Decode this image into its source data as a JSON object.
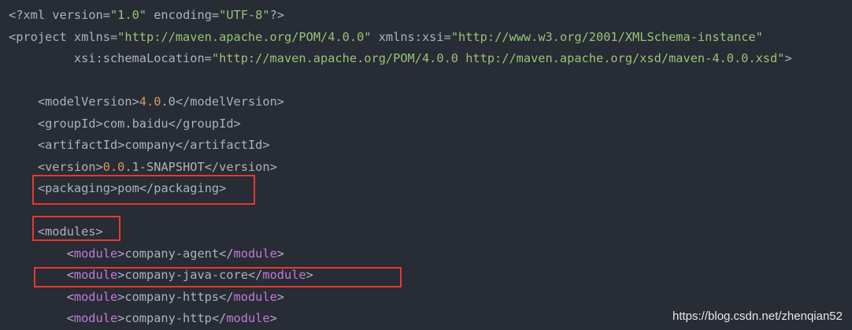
{
  "code": {
    "lines": [
      [
        {
          "t": "<?xml",
          "k": "punct"
        },
        {
          "t": " version=",
          "k": "attr"
        },
        {
          "t": "\"1.0\"",
          "k": "str"
        },
        {
          "t": " encoding=",
          "k": "attr"
        },
        {
          "t": "\"UTF-8\"",
          "k": "str"
        },
        {
          "t": "?>",
          "k": "punct"
        }
      ],
      [
        {
          "t": "<",
          "k": "punct"
        },
        {
          "t": "project",
          "k": "tag"
        },
        {
          "t": " xmlns=",
          "k": "attr"
        },
        {
          "t": "\"http://maven.apache.org/POM/4.0.0\"",
          "k": "str"
        },
        {
          "t": " xmlns:xsi=",
          "k": "attr"
        },
        {
          "t": "\"http://www.w3.org/2001/XMLSchema-instance\"",
          "k": "str"
        }
      ],
      [
        {
          "t": "         xsi:schemaLocation=",
          "k": "attr"
        },
        {
          "t": "\"http://maven.apache.org/POM/4.0.0 http://maven.apache.org/xsd/maven-4.0.0.xsd\"",
          "k": "str"
        },
        {
          "t": ">",
          "k": "punct"
        }
      ],
      [],
      [
        {
          "t": "    <",
          "k": "punct"
        },
        {
          "t": "modelVersion",
          "k": "tag"
        },
        {
          "t": ">",
          "k": "punct"
        },
        {
          "t": "4.0",
          "k": "num"
        },
        {
          "t": ".0",
          "k": "text"
        },
        {
          "t": "</",
          "k": "punct"
        },
        {
          "t": "modelVersion",
          "k": "tag"
        },
        {
          "t": ">",
          "k": "punct"
        }
      ],
      [
        {
          "t": "    <",
          "k": "punct"
        },
        {
          "t": "groupId",
          "k": "tag"
        },
        {
          "t": ">",
          "k": "punct"
        },
        {
          "t": "com.baidu",
          "k": "text"
        },
        {
          "t": "</",
          "k": "punct"
        },
        {
          "t": "groupId",
          "k": "tag"
        },
        {
          "t": ">",
          "k": "punct"
        }
      ],
      [
        {
          "t": "    <",
          "k": "punct"
        },
        {
          "t": "artifactId",
          "k": "tag"
        },
        {
          "t": ">",
          "k": "punct"
        },
        {
          "t": "company",
          "k": "text"
        },
        {
          "t": "</",
          "k": "punct"
        },
        {
          "t": "artifactId",
          "k": "tag"
        },
        {
          "t": ">",
          "k": "punct"
        }
      ],
      [
        {
          "t": "    <",
          "k": "punct"
        },
        {
          "t": "version",
          "k": "tag"
        },
        {
          "t": ">",
          "k": "punct"
        },
        {
          "t": "0.0",
          "k": "num"
        },
        {
          "t": ".1-SNAPSHOT",
          "k": "text"
        },
        {
          "t": "</",
          "k": "punct"
        },
        {
          "t": "version",
          "k": "tag"
        },
        {
          "t": ">",
          "k": "punct"
        }
      ],
      [
        {
          "t": "    <",
          "k": "punct"
        },
        {
          "t": "packaging",
          "k": "tag"
        },
        {
          "t": ">",
          "k": "punct"
        },
        {
          "t": "pom",
          "k": "text"
        },
        {
          "t": "</",
          "k": "punct"
        },
        {
          "t": "packaging",
          "k": "tag"
        },
        {
          "t": ">",
          "k": "punct"
        }
      ],
      [],
      [
        {
          "t": "    <",
          "k": "punct"
        },
        {
          "t": "modules",
          "k": "tag"
        },
        {
          "t": ">",
          "k": "punct"
        }
      ],
      [
        {
          "t": "        <",
          "k": "punct"
        },
        {
          "t": "module",
          "k": "tag-mod"
        },
        {
          "t": ">",
          "k": "punct"
        },
        {
          "t": "company-agent",
          "k": "text"
        },
        {
          "t": "</",
          "k": "punct"
        },
        {
          "t": "module",
          "k": "tag-mod"
        },
        {
          "t": ">",
          "k": "punct"
        }
      ],
      [
        {
          "t": "        <",
          "k": "punct"
        },
        {
          "t": "module",
          "k": "tag-mod"
        },
        {
          "t": ">",
          "k": "punct"
        },
        {
          "t": "company-java-core",
          "k": "text"
        },
        {
          "t": "</",
          "k": "punct"
        },
        {
          "t": "module",
          "k": "tag-mod"
        },
        {
          "t": ">",
          "k": "punct"
        }
      ],
      [
        {
          "t": "        <",
          "k": "punct"
        },
        {
          "t": "module",
          "k": "tag-mod"
        },
        {
          "t": ">",
          "k": "punct"
        },
        {
          "t": "company-https",
          "k": "text"
        },
        {
          "t": "</",
          "k": "punct"
        },
        {
          "t": "module",
          "k": "tag-mod"
        },
        {
          "t": ">",
          "k": "punct"
        }
      ],
      [
        {
          "t": "        <",
          "k": "punct"
        },
        {
          "t": "module",
          "k": "tag-mod"
        },
        {
          "t": ">",
          "k": "punct"
        },
        {
          "t": "company-http",
          "k": "text"
        },
        {
          "t": "</",
          "k": "punct"
        },
        {
          "t": "module",
          "k": "tag-mod"
        },
        {
          "t": ">",
          "k": "punct"
        }
      ]
    ]
  },
  "highlights": {
    "color": "#e53935"
  },
  "watermark": {
    "text": "https://blog.csdn.net/zhenqian52"
  },
  "theme": {
    "background": "#282c34",
    "text": "#abb2bf",
    "string": "#98c379",
    "number": "#d19a66",
    "module_tag": "#c678dd"
  }
}
